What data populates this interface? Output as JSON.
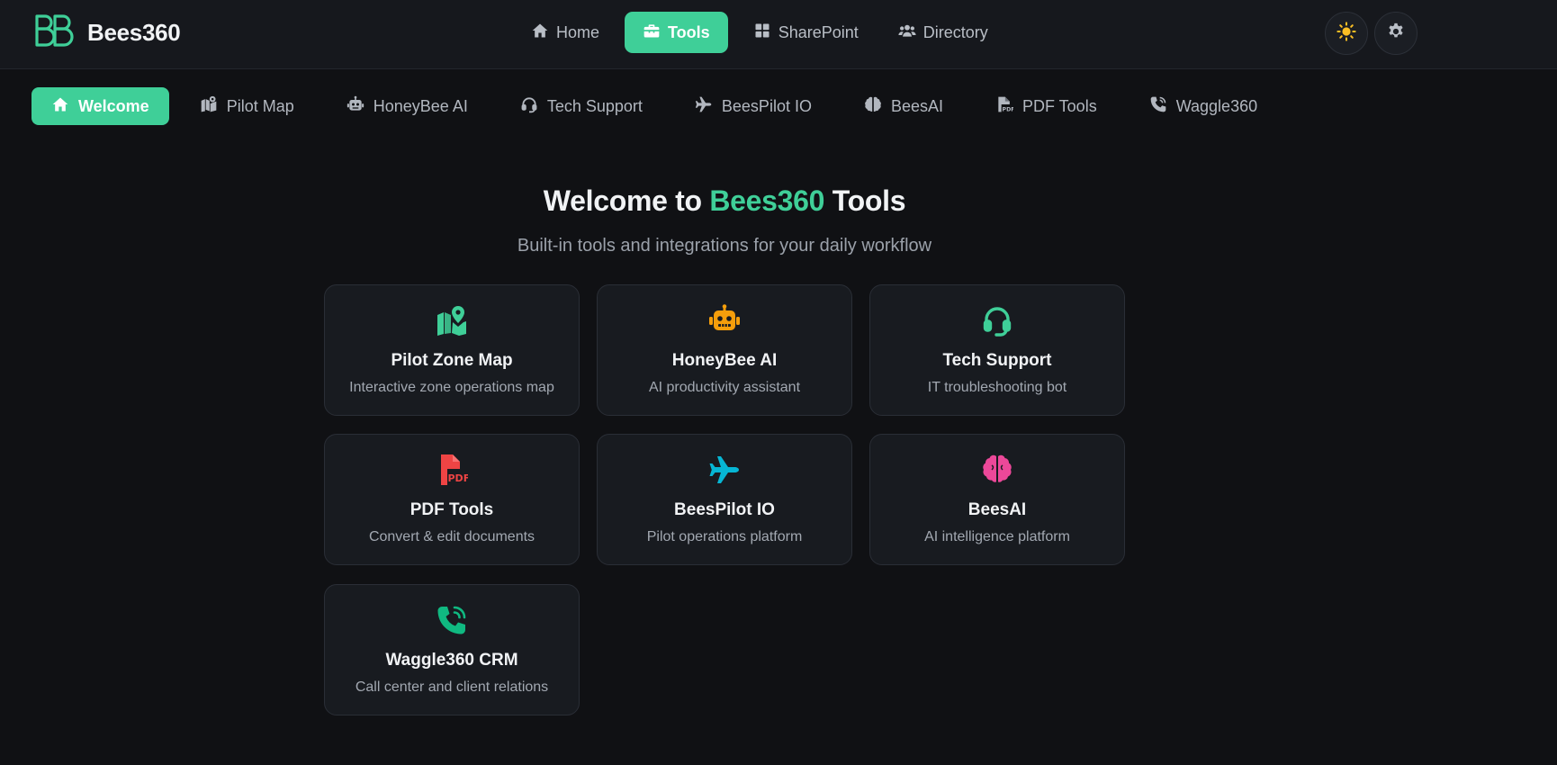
{
  "app": {
    "name": "Bees360"
  },
  "main_nav": [
    {
      "label": "Home",
      "icon": "home-icon"
    },
    {
      "label": "Tools",
      "icon": "toolbox-icon",
      "active": true
    },
    {
      "label": "SharePoint",
      "icon": "grid-icon"
    },
    {
      "label": "Directory",
      "icon": "users-icon"
    }
  ],
  "header_actions": {
    "theme_icon": "sun-icon",
    "settings_icon": "gear-icon"
  },
  "sub_nav": [
    {
      "label": "Welcome",
      "icon": "home-icon",
      "active": true
    },
    {
      "label": "Pilot Map",
      "icon": "map-icon"
    },
    {
      "label": "HoneyBee AI",
      "icon": "robot-icon"
    },
    {
      "label": "Tech Support",
      "icon": "headset-icon"
    },
    {
      "label": "BeesPilot IO",
      "icon": "plane-icon"
    },
    {
      "label": "BeesAI",
      "icon": "brain-icon"
    },
    {
      "label": "PDF Tools",
      "icon": "pdf-file-icon"
    },
    {
      "label": "Waggle360",
      "icon": "phone-icon"
    }
  ],
  "hero": {
    "title_prefix": "Welcome to ",
    "title_accent": "Bees360",
    "title_suffix": " Tools",
    "subtitle": "Built-in tools and integrations for your daily workflow"
  },
  "cards": [
    {
      "title": "Pilot Zone Map",
      "description": "Interactive zone operations map",
      "icon": "map-pin-icon",
      "color": "#3fcf98"
    },
    {
      "title": "HoneyBee AI",
      "description": "AI productivity assistant",
      "icon": "robot-icon",
      "color": "#f59e0b"
    },
    {
      "title": "Tech Support",
      "description": "IT troubleshooting bot",
      "icon": "headset-icon",
      "color": "#3fcf98"
    },
    {
      "title": "PDF Tools",
      "description": "Convert & edit documents",
      "icon": "pdf-file-icon",
      "color": "#ef4444"
    },
    {
      "title": "BeesPilot IO",
      "description": "Pilot operations platform",
      "icon": "plane-icon",
      "color": "#06b6d4"
    },
    {
      "title": "BeesAI",
      "description": "AI intelligence platform",
      "icon": "brain-icon",
      "color": "#ec4899"
    },
    {
      "title": "Waggle360 CRM",
      "description": "Call center and client relations",
      "icon": "phone-volume-icon",
      "color": "#10b981"
    }
  ],
  "colors": {
    "accent": "#3fcf98",
    "background": "#101114",
    "header_bg": "#16181d",
    "card_bg": "#181b20",
    "theme_icon": "#fbbf24"
  }
}
